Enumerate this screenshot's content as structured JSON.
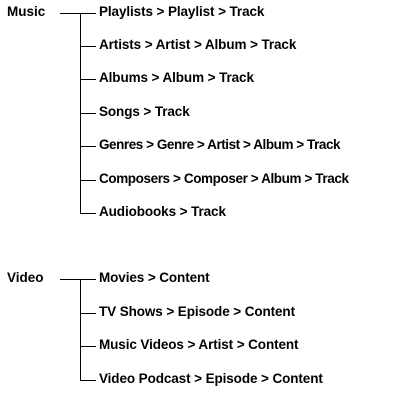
{
  "sections": [
    {
      "root": "Music",
      "items": [
        "Playlists > Playlist > Track",
        "Artists > Artist > Album > Track",
        "Albums > Album > Track",
        "Songs > Track",
        "Genres > Genre > Artist > Album > Track",
        "Composers > Composer > Album > Track",
        "Audiobooks > Track"
      ]
    },
    {
      "root": "Video",
      "items": [
        "Movies > Content",
        "TV Shows > Episode > Content",
        "Music Videos > Artist > Content",
        "Video Podcast > Episode > Content"
      ]
    }
  ]
}
